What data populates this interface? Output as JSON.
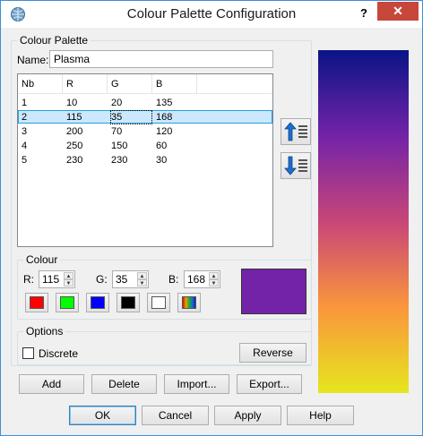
{
  "window": {
    "title": "Colour Palette Configuration",
    "help_label": "?",
    "close_label": "✕"
  },
  "palette_group": {
    "title": "Colour Palette"
  },
  "name_field": {
    "label": "Name:",
    "value": "Plasma"
  },
  "table": {
    "headers": [
      "Nb",
      "R",
      "G",
      "B"
    ],
    "rows": [
      [
        "1",
        "10",
        "20",
        "135"
      ],
      [
        "2",
        "115",
        "35",
        "168"
      ],
      [
        "3",
        "200",
        "70",
        "120"
      ],
      [
        "4",
        "250",
        "150",
        "60"
      ],
      [
        "5",
        "230",
        "230",
        "30"
      ]
    ],
    "selected_row": 2
  },
  "colour_group": {
    "title": "Colour",
    "r_label": "R:",
    "r_value": "115",
    "g_label": "G:",
    "g_value": "35",
    "b_label": "B:",
    "b_value": "168",
    "preview_color": "#7323a8",
    "swatches": [
      "#ff0000",
      "#00ff00",
      "#0000ff",
      "#000000",
      "#ffffff",
      "rainbow"
    ]
  },
  "options_group": {
    "title": "Options",
    "discrete_label": "Discrete",
    "discrete_checked": false,
    "reverse_label": "Reverse"
  },
  "action_buttons": {
    "add": "Add",
    "delete": "Delete",
    "import": "Import...",
    "export": "Export..."
  },
  "dialog_buttons": {
    "ok": "OK",
    "cancel": "Cancel",
    "apply": "Apply",
    "help": "Help"
  },
  "gradient": {
    "colors": [
      "#0a1487",
      "#7323a8",
      "#c84678",
      "#fa963c",
      "#e6e61e"
    ]
  }
}
